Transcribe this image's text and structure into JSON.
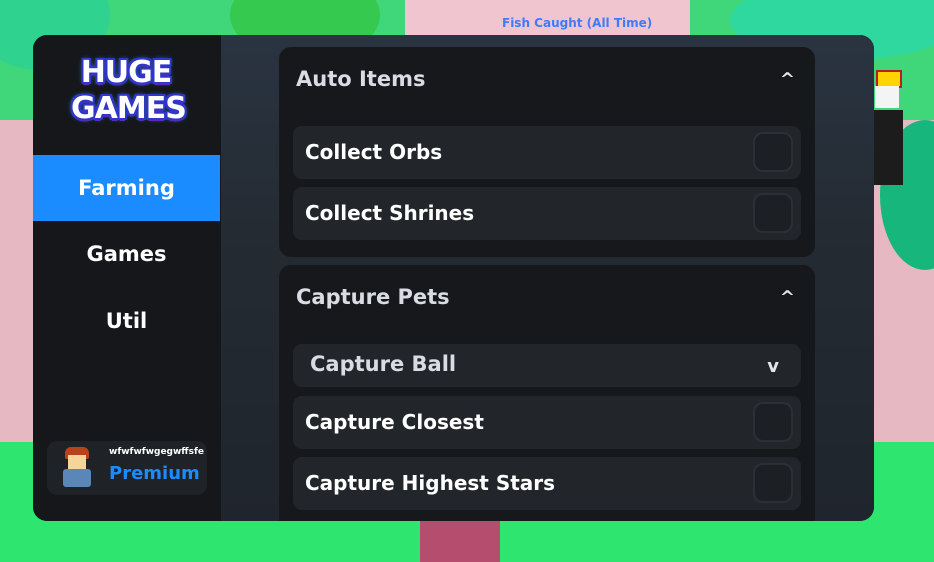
{
  "background": {
    "sign_text": "Fish Caught (All Time)"
  },
  "sidebar": {
    "logo": {
      "line1": "HUGE",
      "line2": "GAMES"
    },
    "items": [
      {
        "label": "Farming",
        "active": true
      },
      {
        "label": "Games",
        "active": false
      },
      {
        "label": "Util",
        "active": false
      }
    ],
    "user": {
      "name": "wfwfwfwgegwffsfe",
      "tier": "Premium"
    }
  },
  "sections": [
    {
      "title": "Auto Items",
      "collapse_glyph": "^",
      "rows": [
        {
          "label": "Collect Orbs",
          "checked": false
        },
        {
          "label": "Collect Shrines",
          "checked": false
        }
      ]
    },
    {
      "title": "Capture Pets",
      "collapse_glyph": "^",
      "dropdown": {
        "label": "Capture Ball",
        "glyph": "v"
      },
      "rows": [
        {
          "label": "Capture Closest",
          "checked": false
        },
        {
          "label": "Capture Highest Stars",
          "checked": false
        }
      ]
    }
  ],
  "colors": {
    "accent": "#1a8cff",
    "panel": "#1c2026",
    "sidebar": "#15171b",
    "row": "#22262b"
  }
}
